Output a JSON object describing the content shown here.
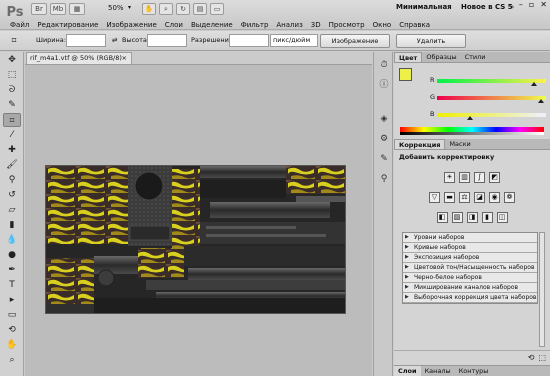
{
  "app": {
    "logo": "Ps",
    "zoom": "50%",
    "workspace_minimal": "Минимальная",
    "workspace_new": "Новое в CS 5",
    "workspace_sep": "»",
    "menu": [
      "Файл",
      "Редактирование",
      "Изображение",
      "Слои",
      "Выделение",
      "Фильтр",
      "Анализ",
      "3D",
      "Просмотр",
      "Окно",
      "Справка"
    ]
  },
  "options": {
    "width_label": "Ширина:",
    "height_label": "Высота:",
    "resolution_label": "Разрешение:",
    "units": "пикс/дюйм",
    "image_button": "Изображение",
    "delete_button": "Удалить"
  },
  "document": {
    "tab_title": "rif_m4a1.vtf @ 50% (RGB/8)",
    "close": "×"
  },
  "color_panel": {
    "tabs": [
      "Цвет",
      "Образцы",
      "Стили"
    ],
    "channels": [
      {
        "label": "R",
        "value": 220,
        "gradient": "linear-gradient(90deg,#00f24a,#ff f24a)"
      },
      {
        "label": "G",
        "value": 240
      },
      {
        "label": "B",
        "value": 74
      }
    ],
    "foreground": "#eef04a"
  },
  "correction_panel": {
    "tabs": [
      "Коррекция",
      "Маски"
    ],
    "title": "Добавить корректировку",
    "presets": [
      "Уровни наборов",
      "Кривые наборов",
      "Экспозиция наборов",
      "Цветовой тон/Насыщенность наборов",
      "Черно-белое наборов",
      "Микширование каналов наборов",
      "Выборочная коррекция цвета наборов"
    ]
  },
  "bottom_tabs": [
    "Слои",
    "Каналы",
    "Контуры"
  ]
}
